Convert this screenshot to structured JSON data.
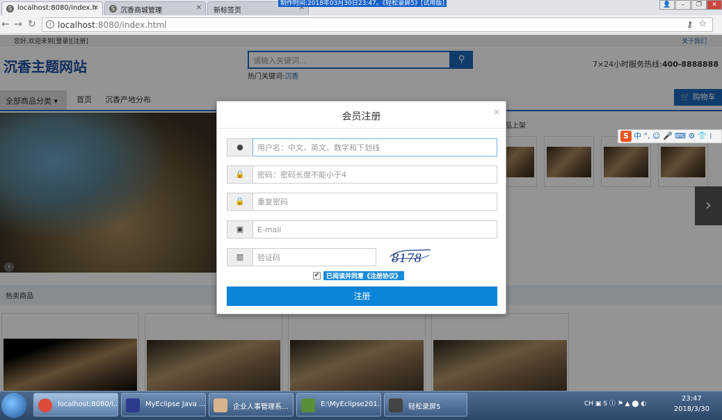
{
  "browser": {
    "tabs": [
      {
        "label": "localhost:8080/index.h",
        "active": true
      },
      {
        "label": "沉香商城管理",
        "active": false
      },
      {
        "label": "新标签页",
        "active": false
      }
    ],
    "recording_banner": "制作时间:2018年03月30日23:47。《轻松录屏5》[试用版]",
    "url_host": "localhost",
    "url_rest": ":8080/index.html"
  },
  "site": {
    "topline_welcome": "您好,欢迎来到[登录][注册]",
    "topline_about": "关于我们",
    "logo": "沉香主题网站",
    "search_placeholder": "请输入关键词...",
    "hot_label": "热门关键词:",
    "hot_word": "沉香",
    "hotline_label": "7×24小时服务热线:",
    "hotline_number": "400-8888888",
    "nav_category": "全部商品分类",
    "nav_links": [
      "首页",
      "沉香产地分布"
    ],
    "cart": "购物车",
    "new_heading": "品上架",
    "hot_heading": "热卖商品"
  },
  "modal": {
    "title": "会员注册",
    "username_placeholder": "用户名：中文、英文、数字和下划线",
    "password_placeholder": "密码：密码长度不能小于4",
    "repeat_password_placeholder": "重复密码",
    "email_placeholder": "E-mail",
    "captcha_placeholder": "验证码",
    "captcha_text": "8178",
    "agree_label": "已阅读并同意《注册协议》",
    "agree_checked": true,
    "submit_label": "注册"
  },
  "ime": {
    "brand": "S",
    "mode": "中"
  },
  "taskbar": {
    "tasks": [
      {
        "label": "localhost:8080/i...",
        "active": true,
        "color": "#dd4b39"
      },
      {
        "label": "MyEclipse Java ...",
        "active": false,
        "color": "#2d3b8c"
      },
      {
        "label": "企业人事管理系...",
        "active": false,
        "color": "#d9b38c"
      },
      {
        "label": "E:\\MyEclipse201...",
        "active": false,
        "color": "#5a8f3a"
      },
      {
        "label": "轻松录屏5",
        "active": false,
        "color": "#444444"
      }
    ],
    "tray_lang": "CH",
    "time": "23:47",
    "date": "2018/3/30"
  }
}
